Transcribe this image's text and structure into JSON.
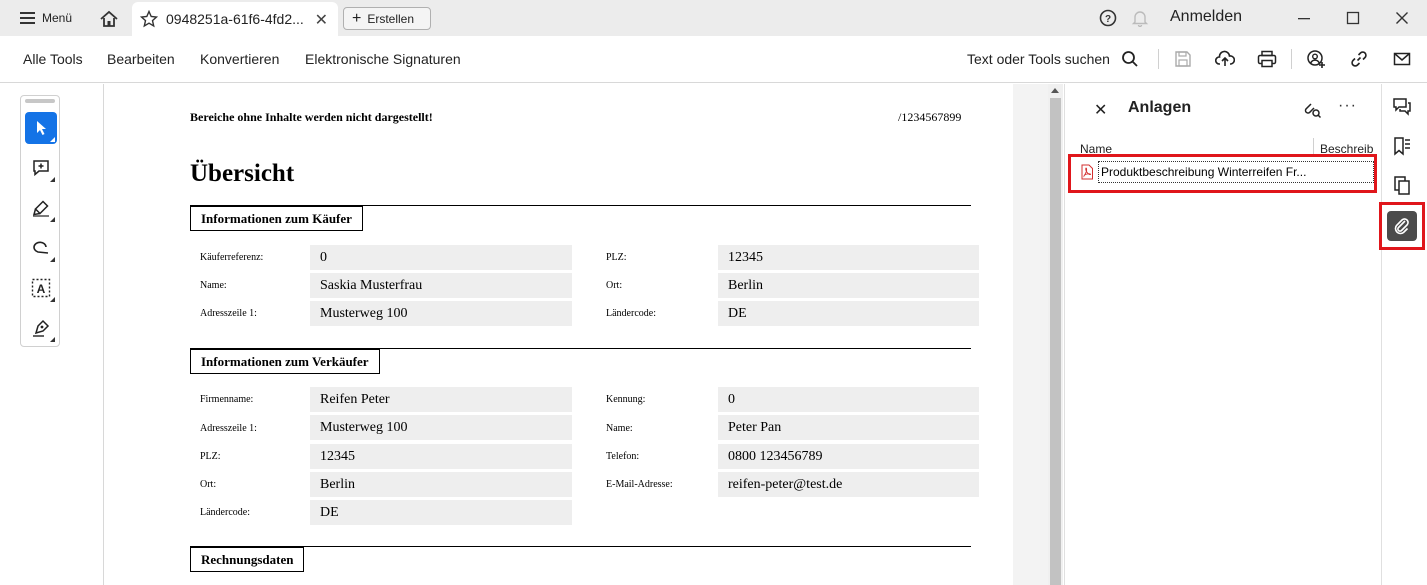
{
  "titlebar": {
    "menu_label": "Menü",
    "tab_title": "0948251a-61f6-4fd2...",
    "create_label": "Erstellen",
    "signin_label": "Anmelden"
  },
  "toolbar": {
    "links": [
      "Alle Tools",
      "Bearbeiten",
      "Konvertieren",
      "Elektronische Signaturen"
    ],
    "search_label": "Text oder Tools suchen"
  },
  "document": {
    "note": "Bereiche ohne Inhalte werden nicht dargestellt!",
    "doc_id": "/1234567899",
    "title": "Übersicht",
    "sections": {
      "buyer": {
        "heading": "Informationen zum Käufer",
        "fields": [
          {
            "label": "Käuferreferenz:",
            "value": "0"
          },
          {
            "label": "Name:",
            "value": "Saskia Musterfrau"
          },
          {
            "label": "Adresszeile 1:",
            "value": "Musterweg 100"
          },
          {
            "label": "PLZ:",
            "value": "12345"
          },
          {
            "label": "Ort:",
            "value": "Berlin"
          },
          {
            "label": "Ländercode:",
            "value": "DE"
          }
        ]
      },
      "seller": {
        "heading": "Informationen zum Verkäufer",
        "fields": [
          {
            "label": "Firmenname:",
            "value": "Reifen Peter"
          },
          {
            "label": "Adresszeile 1:",
            "value": "Musterweg 100"
          },
          {
            "label": "PLZ:",
            "value": "12345"
          },
          {
            "label": "Ort:",
            "value": "Berlin"
          },
          {
            "label": "Ländercode:",
            "value": "DE"
          },
          {
            "label": "Kennung:",
            "value": "0"
          },
          {
            "label": "Name:",
            "value": "Peter Pan"
          },
          {
            "label": "Telefon:",
            "value": "0800 123456789"
          },
          {
            "label": "E-Mail-Adresse:",
            "value": "reifen-peter@test.de"
          }
        ]
      },
      "invoice": {
        "heading": "Rechnungsdaten"
      }
    }
  },
  "attachments_panel": {
    "title": "Anlagen",
    "col_name": "Name",
    "col_description": "Beschreib",
    "items": [
      {
        "name": "Produktbeschreibung Winterreifen Fr..."
      }
    ]
  },
  "accent_color": "#1473e6",
  "highlight_color": "#e0161b"
}
